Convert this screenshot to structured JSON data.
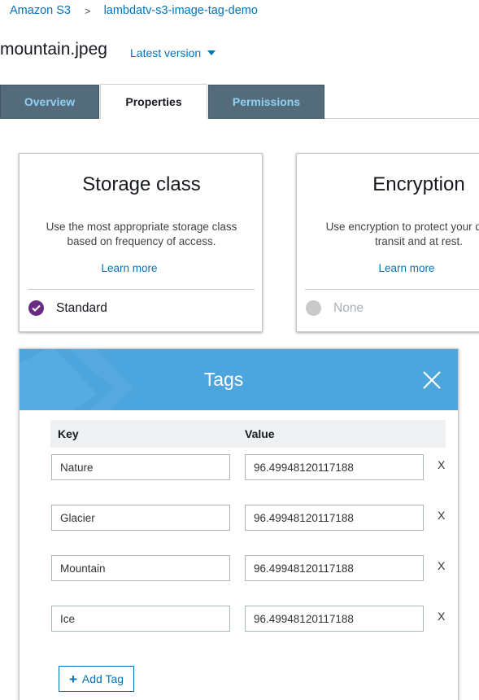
{
  "breadcrumb": {
    "root": "Amazon S3",
    "separator": ">",
    "bucket": "lambdatv-s3-image-tag-demo"
  },
  "object": {
    "name": "mountain.jpeg",
    "version_label": "Latest version"
  },
  "tabs": [
    {
      "label": "Overview",
      "active": false
    },
    {
      "label": "Properties",
      "active": true
    },
    {
      "label": "Permissions",
      "active": false
    }
  ],
  "cards": {
    "storage": {
      "title": "Storage class",
      "description": "Use the most appropriate storage class based on frequency of access.",
      "link": "Learn more",
      "option": "Standard",
      "checked": true
    },
    "encryption": {
      "title": "Encryption",
      "description": "Use encryption to protect your data in-transit and at rest.",
      "link": "Learn more",
      "option": "None",
      "checked": false
    }
  },
  "tags_panel": {
    "title": "Tags",
    "key_header": "Key",
    "value_header": "Value",
    "remove_label": "X",
    "rows": [
      {
        "key": "Nature",
        "value": "96.49948120117188"
      },
      {
        "key": "Glacier",
        "value": "96.49948120117188"
      },
      {
        "key": "Mountain",
        "value": "96.49948120117188"
      },
      {
        "key": "Ice",
        "value": "96.49948120117188"
      }
    ],
    "add_button": "Add Tag"
  },
  "colors": {
    "link": "#0073bb",
    "tab_inactive_bg": "#546b7b",
    "tab_inactive_text": "#8fd2f5",
    "modal_header": "#4da5dd",
    "radio_checked": "#6b2a84"
  },
  "icons": [
    "chevron-right-icon",
    "caret-down-icon",
    "check-icon",
    "close-icon",
    "plus-icon"
  ]
}
